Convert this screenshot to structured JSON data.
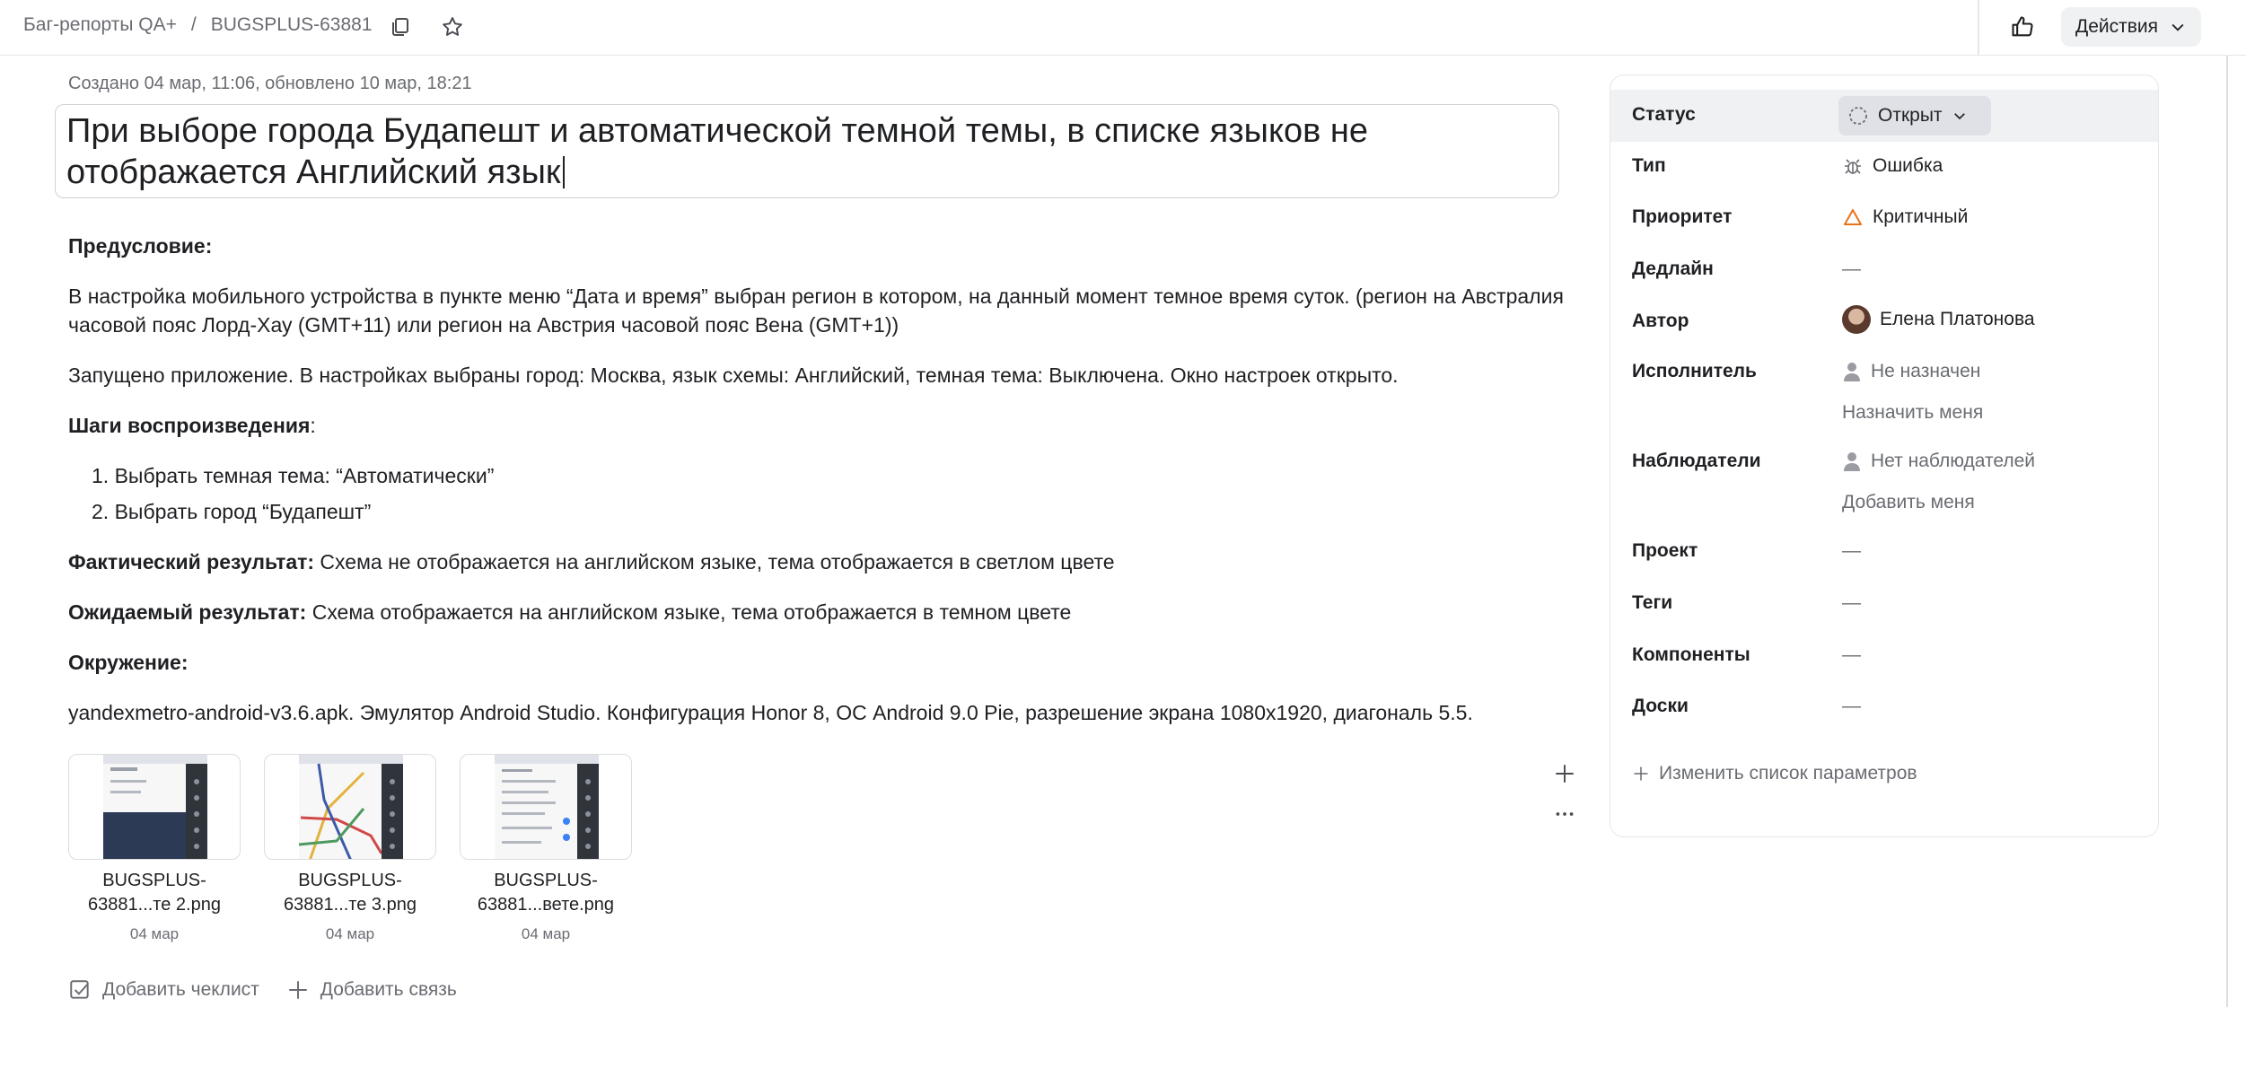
{
  "breadcrumb": {
    "queue": "Баг-репорты QA+",
    "separator": "/",
    "issue_key": "BUGSPLUS-63881"
  },
  "header": {
    "actions_label": "Действия"
  },
  "issue": {
    "meta": "Создано 04 мар, 11:06, обновлено 10 мар, 18:21",
    "title": "При выборе города Будапешт и автоматической темной темы, в списке языков не отображается Английский язык",
    "precondition_heading": "Предусловие:",
    "precondition_text": "В настройка мобильного устройства в пункте меню “Дата и время” выбран регион в котором, на данный момент темное время суток. (регион на Австралия часовой пояс Лорд-Хау (GMT+11) или регион на Австрия часовой пояс Вена (GMT+1))",
    "launch_text": "Запущено приложение. В настройках выбраны город: Москва, язык схемы: Английский, темная тема: Выключена. Окно настроек открыто.",
    "steps_heading": "Шаги воспроизведения",
    "steps_colon": ":",
    "steps": [
      "1. Выбрать темная тема: “Автоматически”",
      "2. Выбрать город “Будапешт”"
    ],
    "actual_label": "Фактический результат:",
    "actual_text": " Схема не отображается на английском языке, тема отображается в светлом цвете",
    "expected_label": "Ожидаемый результат:",
    "expected_text": " Схема отображается на английском языке, тема отображается в темном цвете",
    "env_heading": "Окружение:",
    "env_text": "yandexmetro-android-v3.6.apk. Эмулятор Android Studio. Конфигурация Honor 8, ОС Android 9.0 Pie, разрешение экрана 1080x1920, диагональ 5.5."
  },
  "attachments": [
    {
      "name_line1": "BUGSPLUS-",
      "name_line2": "63881...те 2.png",
      "date": "04 мар"
    },
    {
      "name_line1": "BUGSPLUS-",
      "name_line2": "63881...те 3.png",
      "date": "04 мар"
    },
    {
      "name_line1": "BUGSPLUS-",
      "name_line2": "63881...вете.png",
      "date": "04 мар"
    }
  ],
  "bottom_actions": {
    "checklist": "Добавить чеклист",
    "link": "Добавить связь"
  },
  "panel": {
    "status_label": "Статус",
    "status_value": "Открыт",
    "type_label": "Тип",
    "type_value": "Ошибка",
    "priority_label": "Приоритет",
    "priority_value": "Критичный",
    "deadline_label": "Дедлайн",
    "deadline_value": "—",
    "author_label": "Автор",
    "author_value": "Елена Платонова",
    "assignee_label": "Исполнитель",
    "assignee_value": "Не назначен",
    "assign_me": "Назначить меня",
    "followers_label": "Наблюдатели",
    "followers_value": "Нет наблюдателей",
    "add_me": "Добавить меня",
    "project_label": "Проект",
    "project_value": "—",
    "tags_label": "Теги",
    "tags_value": "—",
    "components_label": "Компоненты",
    "components_value": "—",
    "boards_label": "Доски",
    "boards_value": "—",
    "change_params": "Изменить список параметров"
  },
  "colors": {
    "priority_icon": "#e8741a",
    "muted_text": "#6a6c72",
    "status_pill": "#dfe1e6"
  }
}
